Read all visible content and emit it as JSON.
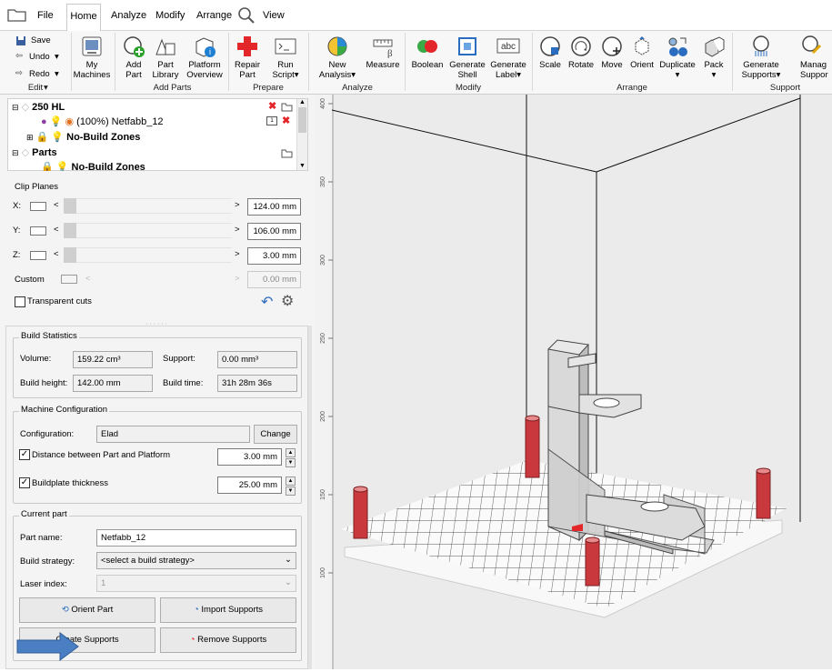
{
  "menu": {
    "file": "File",
    "home": "Home",
    "analyze": "Analyze",
    "modify": "Modify",
    "arrange": "Arrange",
    "view": "View"
  },
  "edit": {
    "save": "Save",
    "undo": "Undo",
    "redo": "Redo",
    "group": "Edit"
  },
  "ribbon": {
    "my_machines": [
      "My",
      "Machines"
    ],
    "add_part": [
      "Add",
      "Part"
    ],
    "part_library": [
      "Part",
      "Library"
    ],
    "platform_overview": [
      "Platform",
      "Overview"
    ],
    "add_parts_group": "Add Parts",
    "repair_part": [
      "Repair",
      "Part"
    ],
    "run_script": [
      "Run",
      "Script"
    ],
    "prepare_group": "Prepare",
    "new_analysis": [
      "New",
      "Analysis"
    ],
    "measure": "Measure",
    "analyze_group": "Analyze",
    "boolean": "Boolean",
    "generate_shell": [
      "Generate",
      "Shell"
    ],
    "generate_label": [
      "Generate",
      "Label"
    ],
    "modify_group": "Modify",
    "scale": "Scale",
    "rotate": "Rotate",
    "move": "Move",
    "orient": "Orient",
    "duplicate": "Duplicate",
    "pack": "Pack",
    "arrange_group": "Arrange",
    "generate_supports": [
      "Generate",
      "Supports"
    ],
    "manage_supports": [
      "Manag",
      "Suppor"
    ],
    "support_group": "Support"
  },
  "tree": {
    "machine": "250 HL",
    "part": "(100%) Netfabb_12",
    "nobuild1": "No-Build Zones",
    "parts": "Parts",
    "nobuild2": "No-Build Zones"
  },
  "clip": {
    "title": "Clip Planes",
    "x_label": "X:",
    "x_value": "124.00 mm",
    "y_label": "Y:",
    "y_value": "106.00 mm",
    "z_label": "Z:",
    "z_value": "3.00 mm",
    "custom_label": "Custom",
    "custom_value": "0.00 mm",
    "transparent": "Transparent cuts"
  },
  "stats": {
    "title": "Build Statistics",
    "volume_label": "Volume:",
    "volume": "159.22 cm³",
    "support_label": "Support:",
    "support": "0.00 mm³",
    "height_label": "Build height:",
    "height": "142.00 mm",
    "time_label": "Build time:",
    "time": "31h 28m 36s"
  },
  "machine": {
    "title": "Machine Configuration",
    "config_label": "Configuration:",
    "config": "Elad",
    "change": "Change",
    "distance_label": "Distance between Part and Platform",
    "distance": "3.00 mm",
    "thickness_label": "Buildplate thickness",
    "thickness": "25.00 mm"
  },
  "current": {
    "title": "Current part",
    "name_label": "Part name:",
    "name": "Netfabb_12",
    "strategy_label": "Build strategy:",
    "strategy": "<select a build strategy>",
    "laser_label": "Laser index:",
    "laser": "1",
    "orient": "Orient Part",
    "import": "Import Supports",
    "create": "Create Supports",
    "remove": "Remove Supports"
  },
  "ruler": {
    "ticks": [
      "400",
      "350",
      "300",
      "250",
      "200",
      "150",
      "100"
    ]
  }
}
